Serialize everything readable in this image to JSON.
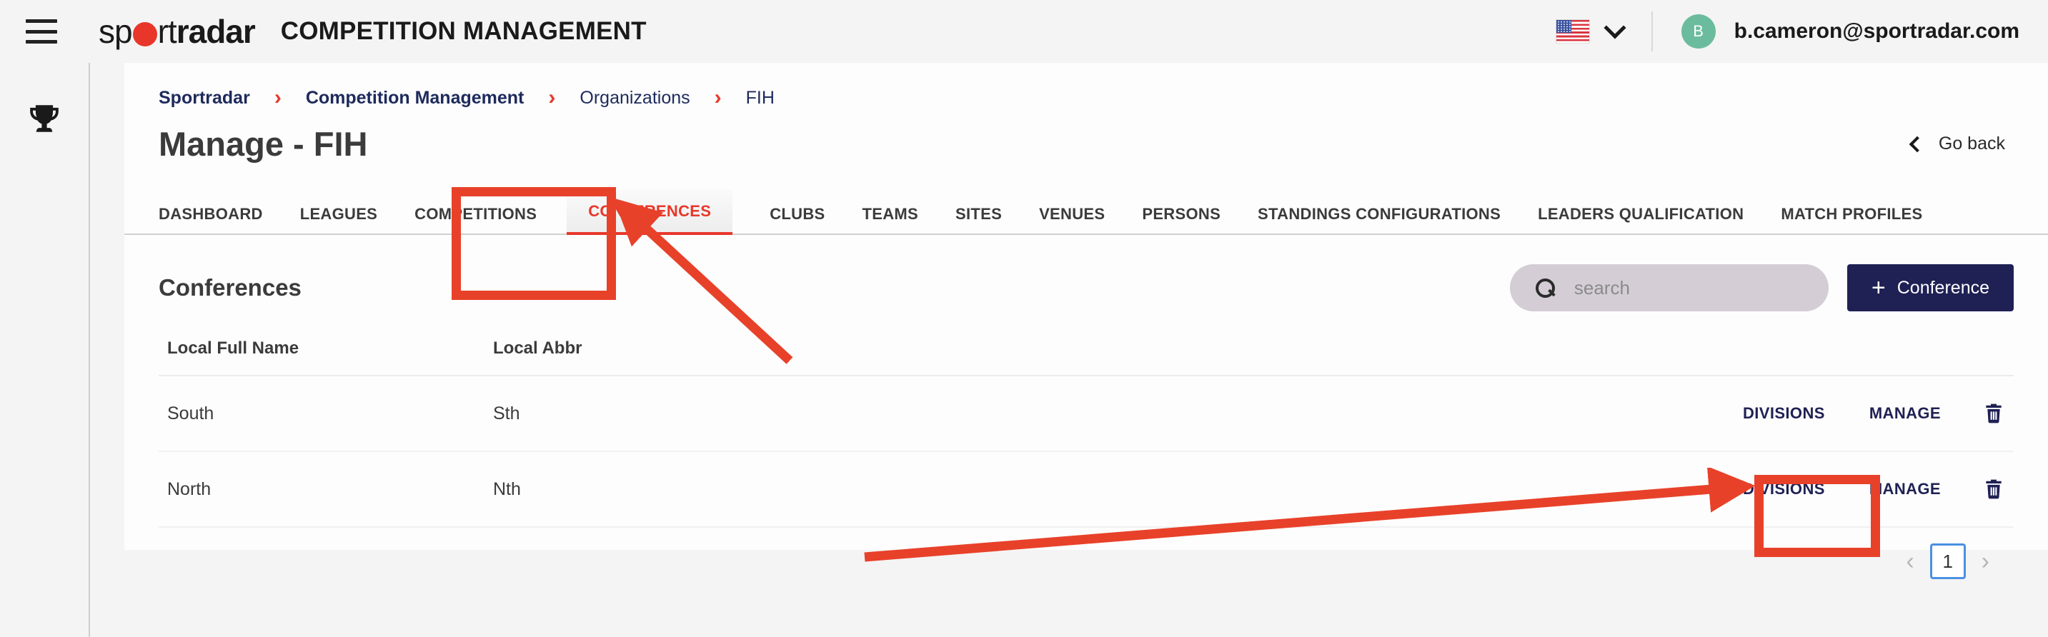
{
  "topbar": {
    "menu_icon": "hamburger-icon",
    "logo_sp": "sp",
    "logo_o": "o",
    "logo_rt": "rt",
    "logo_radar": "radar",
    "app_title": "COMPETITION MANAGEMENT",
    "language_flag": "us-flag-icon",
    "language_chevron": "chevron-down-icon",
    "avatar_initial": "B",
    "user_email": "b.cameron@sportradar.com"
  },
  "rail": {
    "item_icon": "trophy-icon"
  },
  "breadcrumb": {
    "items": [
      {
        "label": "Sportradar",
        "bold": true
      },
      {
        "label": "Competition Management",
        "bold": true
      },
      {
        "label": "Organizations",
        "bold": false
      },
      {
        "label": "FIH",
        "bold": false
      }
    ],
    "separator": "›"
  },
  "page": {
    "title": "Manage - FIH",
    "go_back_label": "Go back",
    "go_back_icon": "chevron-left-icon"
  },
  "tabs": [
    {
      "label": "DASHBOARD",
      "active": false
    },
    {
      "label": "LEAGUES",
      "active": false
    },
    {
      "label": "COMPETITIONS",
      "active": false
    },
    {
      "label": "CONFERENCES",
      "active": true
    },
    {
      "label": "CLUBS",
      "active": false
    },
    {
      "label": "TEAMS",
      "active": false
    },
    {
      "label": "SITES",
      "active": false
    },
    {
      "label": "VENUES",
      "active": false
    },
    {
      "label": "PERSONS",
      "active": false
    },
    {
      "label": "STANDINGS CONFIGURATIONS",
      "active": false
    },
    {
      "label": "LEADERS QUALIFICATION",
      "active": false
    },
    {
      "label": "MATCH PROFILES",
      "active": false
    }
  ],
  "section": {
    "title": "Conferences",
    "search_placeholder": "search",
    "search_value": "",
    "search_icon": "search-icon",
    "add_button_label": "Conference",
    "add_button_plus": "+"
  },
  "table": {
    "columns": [
      "Local Full Name",
      "Local Abbr"
    ],
    "rows": [
      {
        "local_full_name": "South",
        "local_abbr": "Sth",
        "divisions_label": "DIVISIONS",
        "manage_label": "MANAGE",
        "delete_icon": "trash-icon"
      },
      {
        "local_full_name": "North",
        "local_abbr": "Nth",
        "divisions_label": "DIVISIONS",
        "manage_label": "MANAGE",
        "delete_icon": "trash-icon"
      }
    ]
  },
  "pagination": {
    "prev": "‹",
    "current_page": "1",
    "next": "›"
  },
  "colors": {
    "brand_red": "#e8372a",
    "annotation_red": "#e8412a",
    "navy": "#1f2154",
    "breadcrumb_navy": "#1d2a5c",
    "avatar_green": "#6bbc9d",
    "search_bg": "#d4cdd6",
    "page_bg": "#f4f4f4",
    "focus_blue": "#4a90e2"
  }
}
